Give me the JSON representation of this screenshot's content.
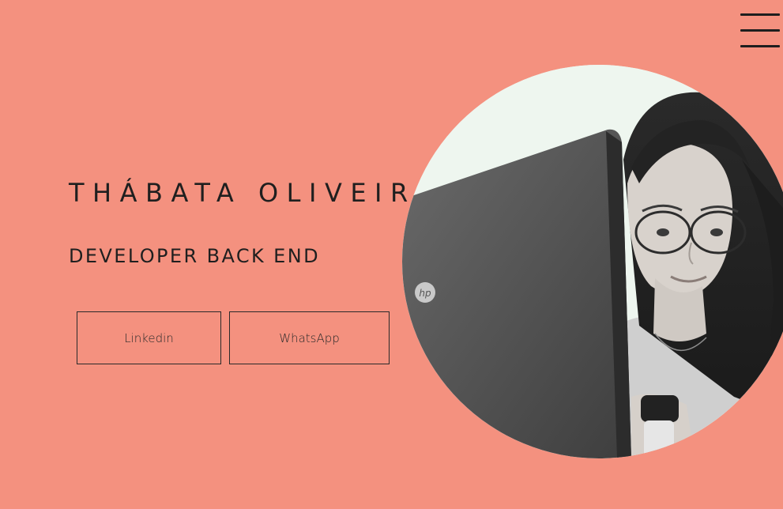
{
  "header": {
    "menu_icon": "hamburger-menu-icon"
  },
  "hero": {
    "name": "THÁBATA OLIVEIRA",
    "role": "DEVELOPER BACK END",
    "buttons": {
      "linkedin_label": "Linkedin",
      "whatsapp_label": "WhatsApp"
    }
  },
  "portrait": {
    "laptop_logo": "hp"
  },
  "colors": {
    "background": "#f4917f",
    "text": "#1f1f1f",
    "border": "#2a2a2a"
  }
}
